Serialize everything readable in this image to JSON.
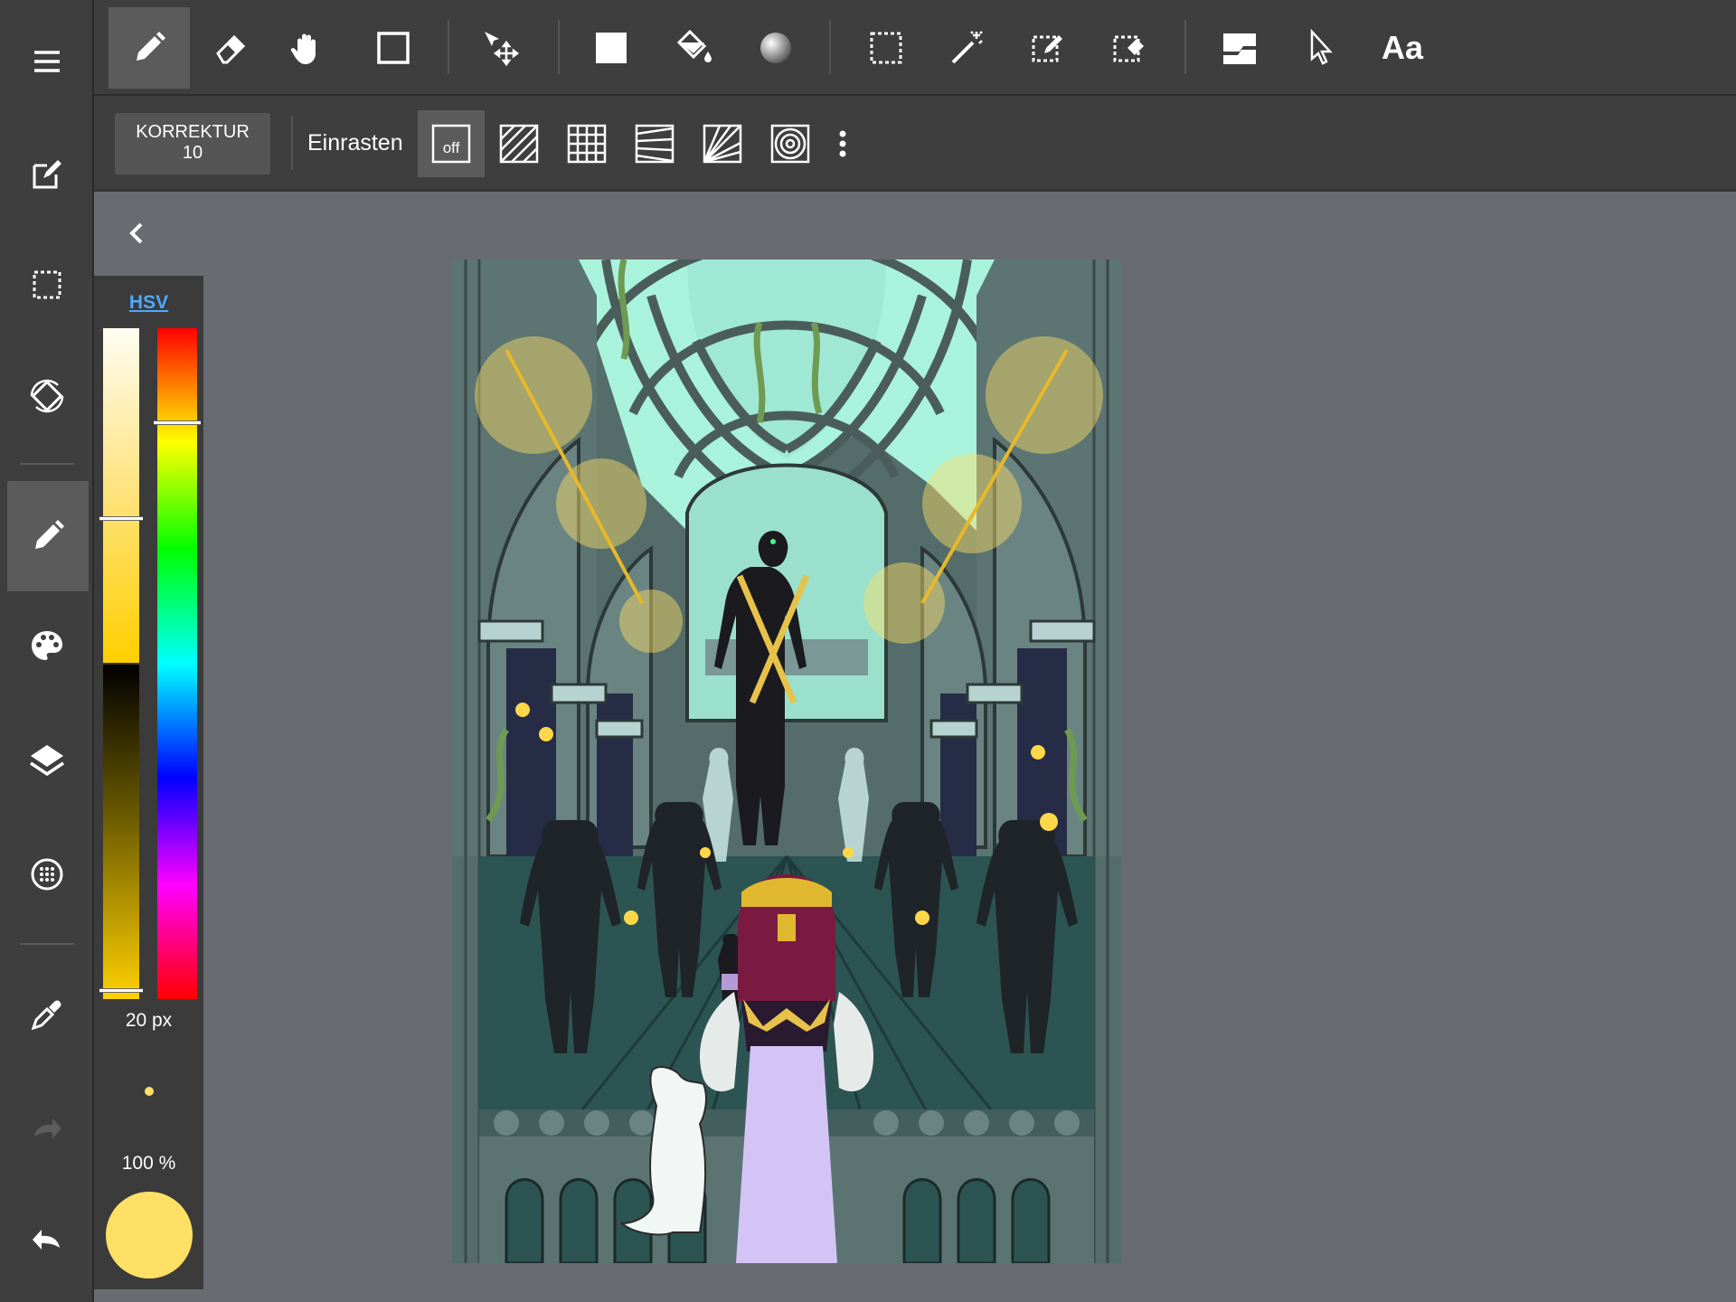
{
  "toolbar": {
    "tools": [
      "brush",
      "eraser",
      "hand",
      "rectangle",
      "move",
      "fill-rect",
      "bucket-fill",
      "gradient",
      "select-rect",
      "magic-wand",
      "select-pen",
      "select-eraser",
      "frame",
      "operation",
      "text"
    ],
    "text_tool_label": "Aa"
  },
  "sub_toolbar": {
    "correction_label": "KORREKTUR",
    "correction_value": "10",
    "snap_label": "Einrasten",
    "snap_off_label": "off",
    "snap_options": [
      "off",
      "parallel",
      "grid",
      "perspective-lines",
      "radial",
      "concentric"
    ]
  },
  "color_panel": {
    "mode_label": "HSV",
    "brush_size": "20 px",
    "opacity": "100 %",
    "current_color": "#ffe066"
  },
  "left_rail": {
    "items": [
      "menu",
      "edit",
      "selection",
      "transform",
      "brush",
      "palette",
      "layers",
      "material",
      "eyedropper",
      "redo",
      "undo"
    ],
    "active": "brush"
  },
  "colors": {
    "ui_dark": "#3e3e3e",
    "ui_active": "#5b5b5b",
    "workspace": "#686b70",
    "accent_link": "#4fa8ff"
  }
}
